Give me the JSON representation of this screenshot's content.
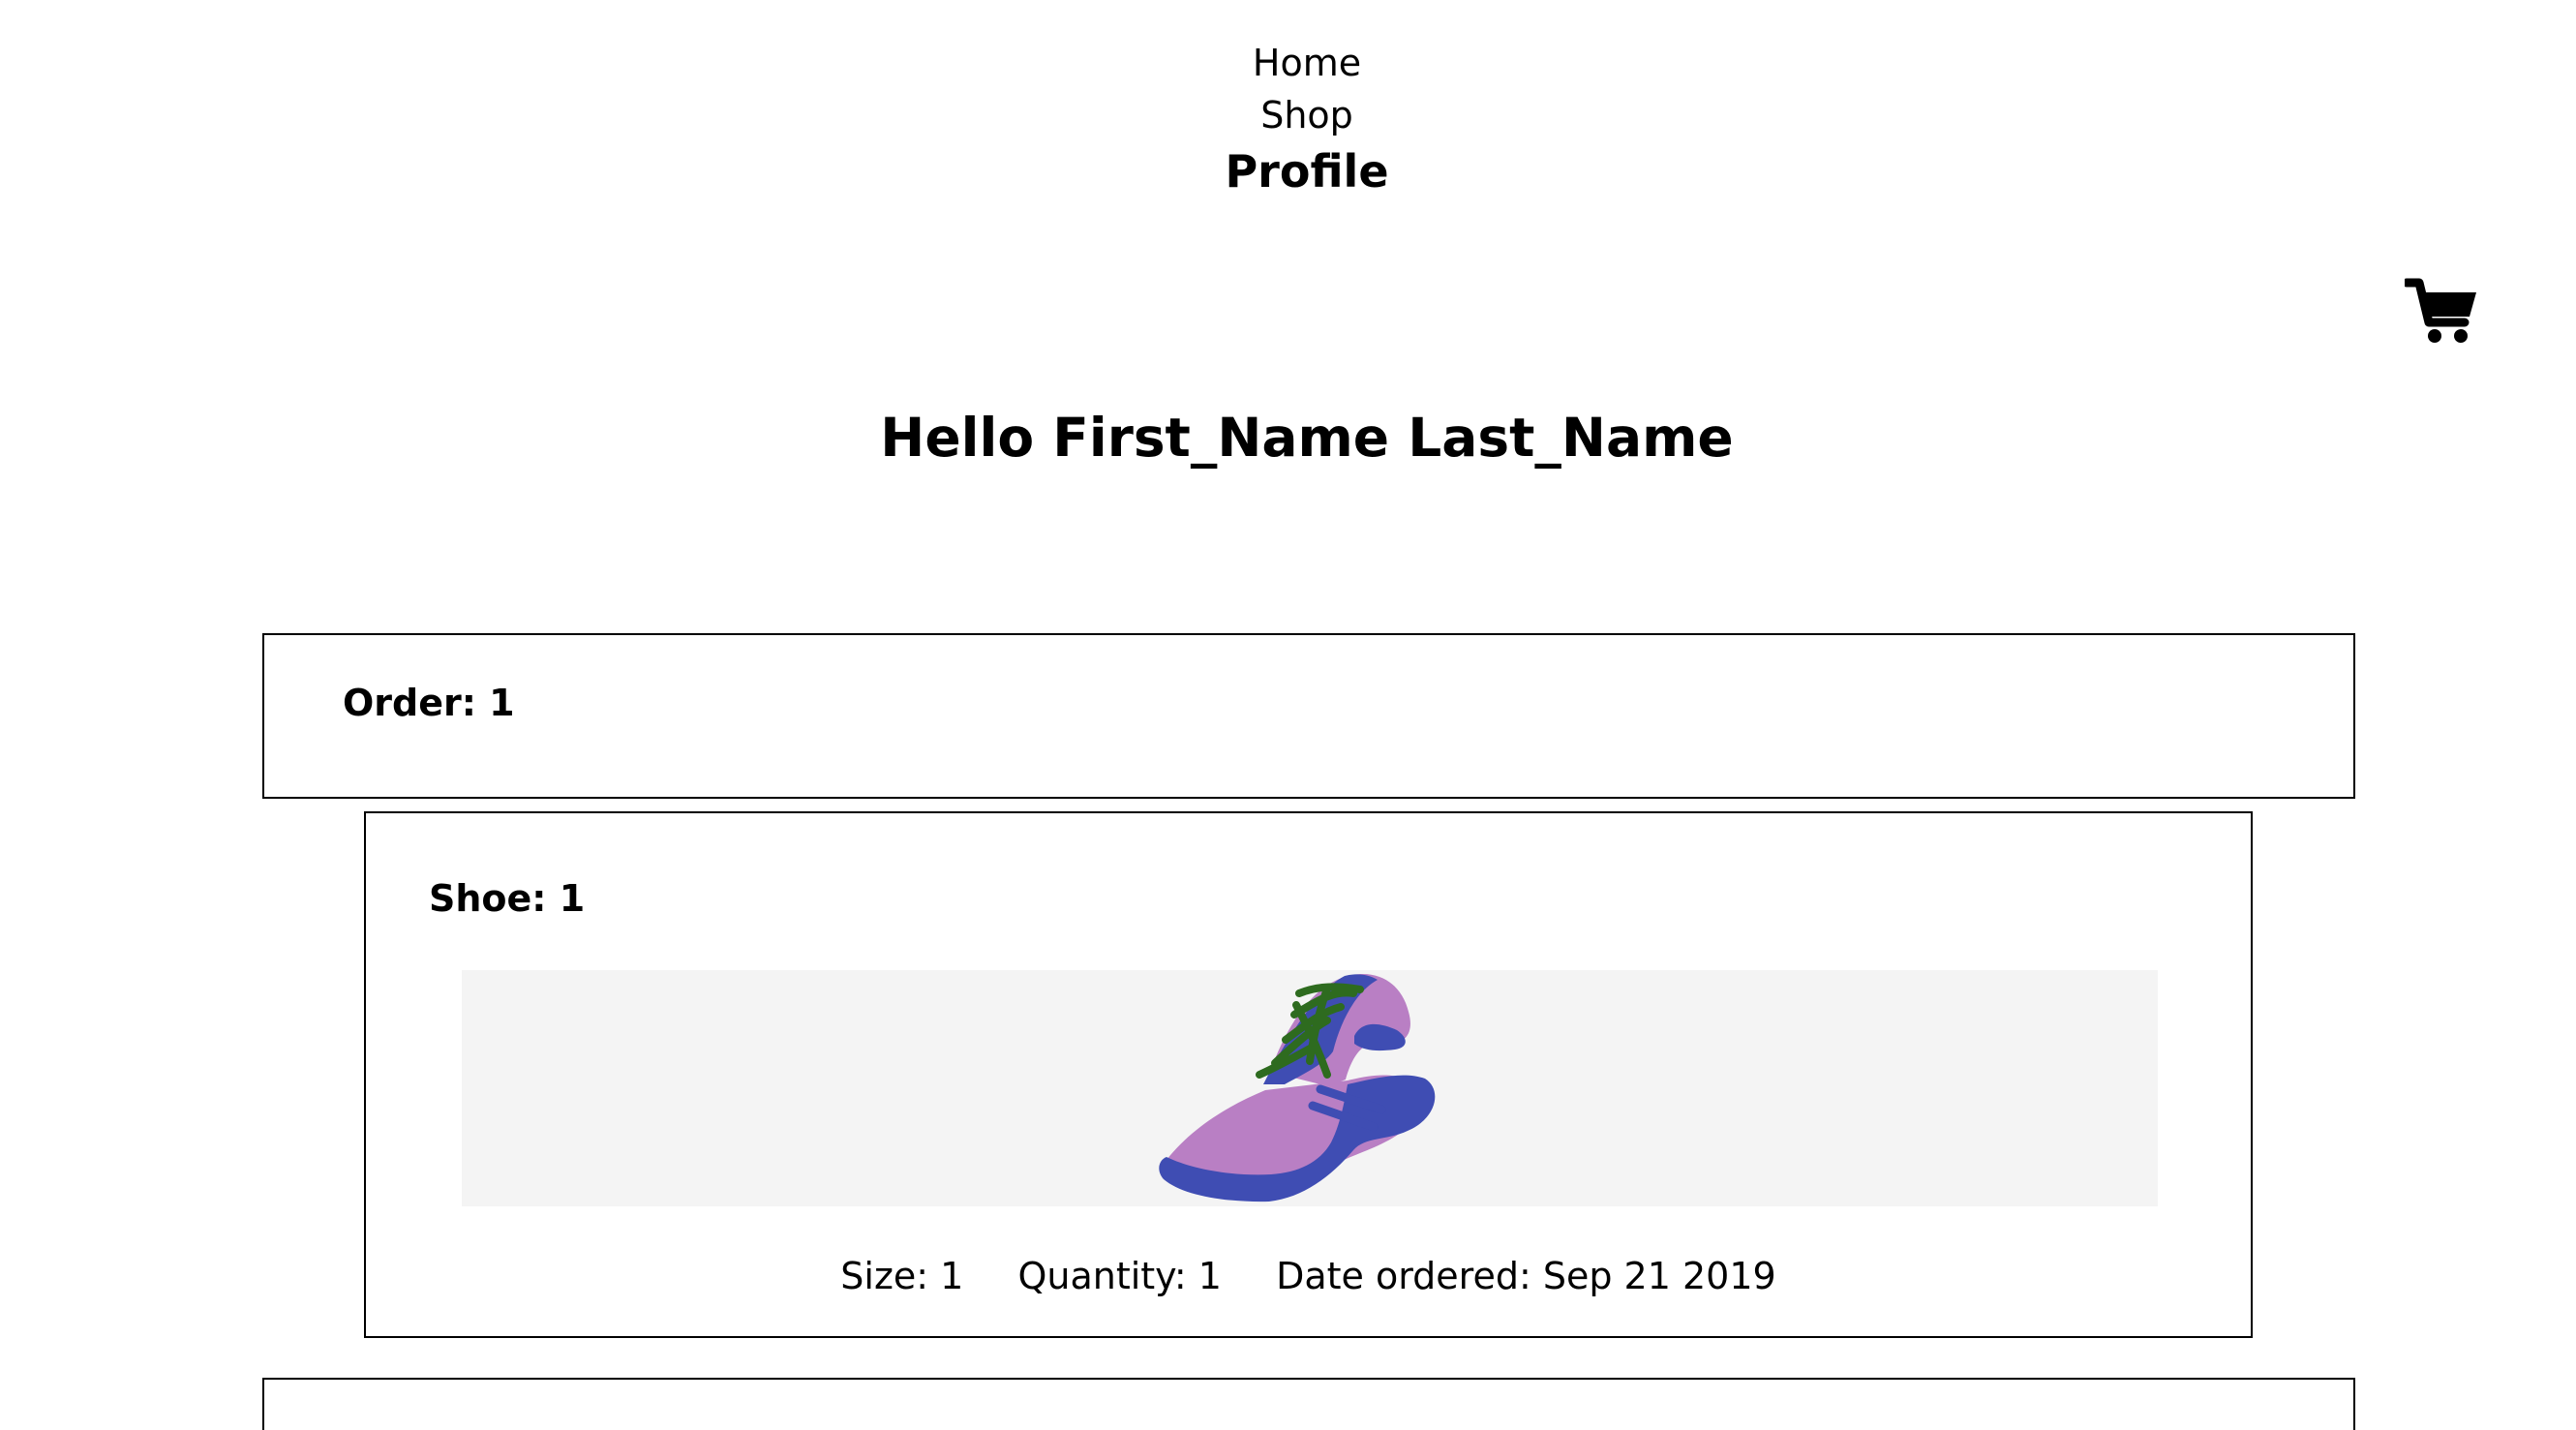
{
  "nav": {
    "home": "Home",
    "shop": "Shop",
    "profile": "Profile"
  },
  "cart": {
    "icon": "shopping-cart-icon"
  },
  "greeting": "Hello First_Name Last_Name",
  "orders": [
    {
      "title": "Order: 1",
      "shoes": [
        {
          "title": "Shoe: 1",
          "image_icon": "sneaker-icon",
          "size": "Size: 1",
          "quantity": "Quantity: 1",
          "date_ordered": "Date ordered: Sep 21 2019"
        }
      ]
    }
  ],
  "colors": {
    "shoe_body": "#b97fc4",
    "shoe_trim": "#3f4db3",
    "shoe_laces": "#2e6b1f",
    "image_background": "#f4f4f4"
  }
}
